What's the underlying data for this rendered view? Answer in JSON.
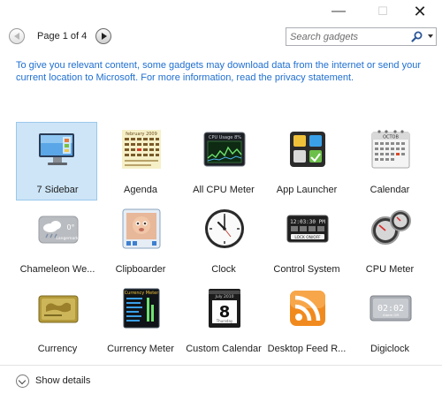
{
  "window": {
    "minimize_glyph": "—",
    "maximize_glyph": "☐",
    "close_glyph": "✕"
  },
  "pager": {
    "label": "Page 1 of 4",
    "prev_icon": "left-arrow-icon",
    "next_icon": "right-arrow-icon"
  },
  "search": {
    "placeholder": "Search gadgets",
    "value": "",
    "icon": "search-icon"
  },
  "notice": {
    "text": "To give you relevant content, some gadgets may download data from the internet or send your current location to Microsoft. For more information, read the privacy statement."
  },
  "gadgets": [
    {
      "label": "7 Sidebar",
      "icon": "sidebar-icon",
      "selected": true
    },
    {
      "label": "Agenda",
      "icon": "agenda-icon",
      "selected": false
    },
    {
      "label": "All CPU Meter",
      "icon": "cpu-graph-icon",
      "selected": false
    },
    {
      "label": "App Launcher",
      "icon": "app-launcher-icon",
      "selected": false
    },
    {
      "label": "Calendar",
      "icon": "calendar-icon",
      "selected": false
    },
    {
      "label": "Chameleon We...",
      "icon": "weather-icon",
      "selected": false
    },
    {
      "label": "Clipboarder",
      "icon": "clipboard-icon",
      "selected": false
    },
    {
      "label": "Clock",
      "icon": "clock-icon",
      "selected": false
    },
    {
      "label": "Control System",
      "icon": "control-system-icon",
      "selected": false
    },
    {
      "label": "CPU Meter",
      "icon": "cpu-meter-icon",
      "selected": false
    },
    {
      "label": "Currency",
      "icon": "currency-icon",
      "selected": false
    },
    {
      "label": "Currency Meter",
      "icon": "currency-meter-icon",
      "selected": false
    },
    {
      "label": "Custom Calendar",
      "icon": "custom-calendar-icon",
      "selected": false
    },
    {
      "label": "Desktop Feed R...",
      "icon": "rss-feed-icon",
      "selected": false
    },
    {
      "label": "Digiclock",
      "icon": "digital-clock-icon",
      "selected": false
    }
  ],
  "icon_text": {
    "agenda_title": "february 2009",
    "cpu_title": "CPU Usage",
    "cpu_value": "8%",
    "calendar_month": "OCTOB",
    "weather_temp": "0°",
    "weather_place": "Langemark",
    "control_time": "12:03:30 PM",
    "control_lock": "LOCK ON/OFF",
    "currency_meter_title": "Currency Meter",
    "custom_cal_month": "July 2010",
    "custom_cal_day": "8",
    "custom_cal_weekday": "Thursday",
    "digiclock_time": "02:02",
    "digiclock_sub": "Alarm Off"
  },
  "footer": {
    "details_label": "Show details"
  },
  "colors": {
    "link": "#1f6fd1",
    "selected_bg": "#cde5f7",
    "selected_border": "#9bc8ec"
  }
}
